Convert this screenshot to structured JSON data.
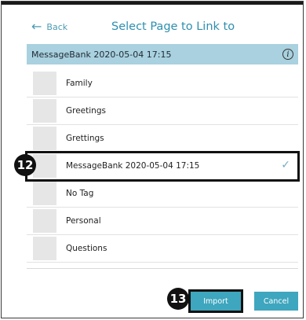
{
  "nav": {
    "back_label": "Back",
    "title": "Select Page to Link to"
  },
  "header": {
    "label": "MessageBank 2020-05-04 17:15"
  },
  "pages": [
    {
      "label": "Family"
    },
    {
      "label": "Greetings"
    },
    {
      "label": "Grettings"
    },
    {
      "label": "MessageBank 2020-05-04 17:15",
      "selected": true
    },
    {
      "label": "No Tag"
    },
    {
      "label": "Personal"
    },
    {
      "label": "Questions"
    }
  ],
  "annotations": {
    "step_a": "12",
    "step_b": "13"
  },
  "actions": {
    "import_label": "Import",
    "cancel_label": "Cancel"
  },
  "colors": {
    "accent": "#3ea6be",
    "header_bg": "#a9d1df",
    "title": "#2d8fb0"
  }
}
